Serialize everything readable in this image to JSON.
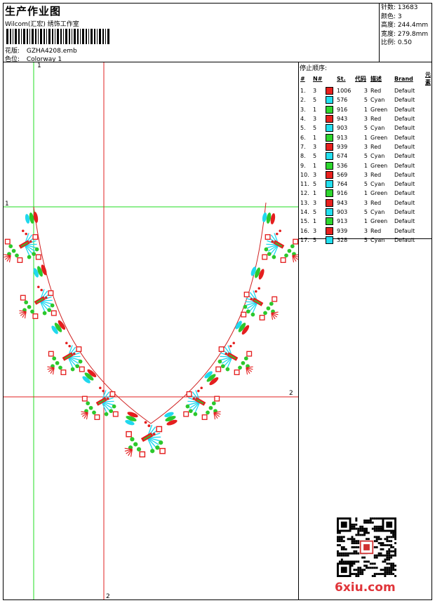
{
  "header": {
    "title": "生产作业图",
    "subtitle": "Wilcom(汇宏) 绣饰工作室",
    "design_label": "花版:",
    "design_value": "GZHA4208.emb",
    "colorway_label": "色位:",
    "colorway_value": "Colorway 1"
  },
  "specs": {
    "stitches": "针数: 13683",
    "colors": "颜色: 3",
    "height": "高度: 244.4mm",
    "width": "宽度: 279.8mm",
    "scale": "比例: 0.50"
  },
  "stop_sequence": {
    "title": "停止顺序:",
    "columns": [
      "#",
      "N#",
      "St.",
      "代码",
      "描述",
      "Brand",
      "元素"
    ],
    "rows": [
      {
        "idx": "1.",
        "n": "3",
        "color": "#e8201e",
        "st": "1006",
        "code": "3",
        "desc": "Red",
        "brand": "Default"
      },
      {
        "idx": "2.",
        "n": "5",
        "color": "#22e0f0",
        "st": "576",
        "code": "5",
        "desc": "Cyan",
        "brand": "Default"
      },
      {
        "idx": "3.",
        "n": "1",
        "color": "#2ed62e",
        "st": "916",
        "code": "1",
        "desc": "Green",
        "brand": "Default"
      },
      {
        "idx": "4.",
        "n": "3",
        "color": "#e8201e",
        "st": "943",
        "code": "3",
        "desc": "Red",
        "brand": "Default"
      },
      {
        "idx": "5.",
        "n": "5",
        "color": "#22e0f0",
        "st": "903",
        "code": "5",
        "desc": "Cyan",
        "brand": "Default"
      },
      {
        "idx": "6.",
        "n": "1",
        "color": "#2ed62e",
        "st": "913",
        "code": "1",
        "desc": "Green",
        "brand": "Default"
      },
      {
        "idx": "7.",
        "n": "3",
        "color": "#e8201e",
        "st": "939",
        "code": "3",
        "desc": "Red",
        "brand": "Default"
      },
      {
        "idx": "8.",
        "n": "5",
        "color": "#22e0f0",
        "st": "674",
        "code": "5",
        "desc": "Cyan",
        "brand": "Default"
      },
      {
        "idx": "9.",
        "n": "1",
        "color": "#2ed62e",
        "st": "536",
        "code": "1",
        "desc": "Green",
        "brand": "Default"
      },
      {
        "idx": "10.",
        "n": "3",
        "color": "#e8201e",
        "st": "569",
        "code": "3",
        "desc": "Red",
        "brand": "Default"
      },
      {
        "idx": "11.",
        "n": "5",
        "color": "#22e0f0",
        "st": "764",
        "code": "5",
        "desc": "Cyan",
        "brand": "Default"
      },
      {
        "idx": "12.",
        "n": "1",
        "color": "#2ed62e",
        "st": "916",
        "code": "1",
        "desc": "Green",
        "brand": "Default"
      },
      {
        "idx": "13.",
        "n": "3",
        "color": "#e8201e",
        "st": "943",
        "code": "3",
        "desc": "Red",
        "brand": "Default"
      },
      {
        "idx": "14.",
        "n": "5",
        "color": "#22e0f0",
        "st": "903",
        "code": "5",
        "desc": "Cyan",
        "brand": "Default"
      },
      {
        "idx": "15.",
        "n": "1",
        "color": "#2ed62e",
        "st": "913",
        "code": "1",
        "desc": "Green",
        "brand": "Default"
      },
      {
        "idx": "16.",
        "n": "3",
        "color": "#e8201e",
        "st": "939",
        "code": "3",
        "desc": "Red",
        "brand": "Default"
      },
      {
        "idx": "17.",
        "n": "5",
        "color": "#22e0f0",
        "st": "328",
        "code": "5",
        "desc": "Cyan",
        "brand": "Default"
      }
    ]
  },
  "guides": {
    "label_1": "1",
    "label_2": "2",
    "green": "#22dd22",
    "red": "#e02020"
  },
  "watermark": "6xiu.com"
}
